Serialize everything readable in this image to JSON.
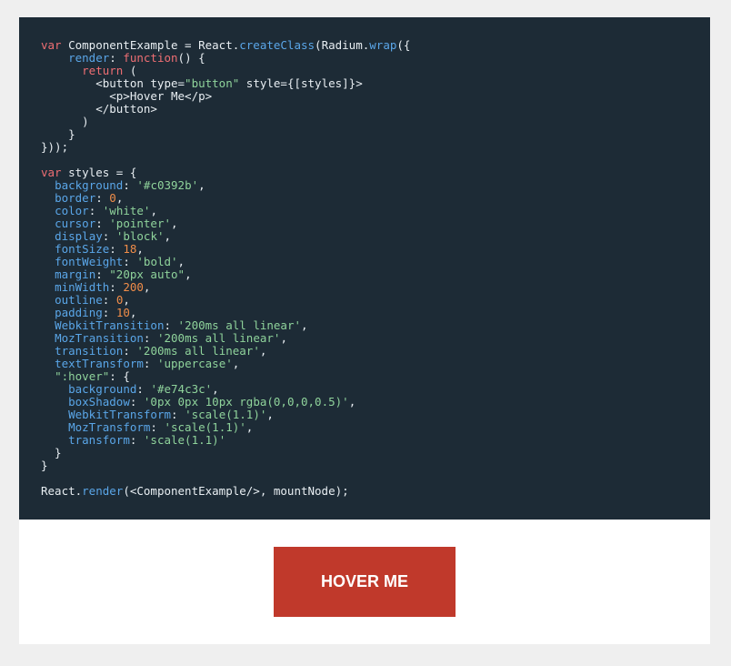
{
  "colors": {
    "page_background": "#efefef",
    "code_background": "#1d2b36",
    "keyword": "#ee6e73",
    "property": "#5aa6e8",
    "string": "#8fd39b",
    "number": "#f08d49",
    "plain_text": "#e8eef2",
    "button_background": "#c0392b",
    "button_text": "#ffffff"
  },
  "code_lines": [
    [
      [
        "kw",
        "var"
      ],
      [
        "txt",
        " ComponentExample = React."
      ],
      [
        "prop",
        "createClass"
      ],
      [
        "txt",
        "(Radium."
      ],
      [
        "prop",
        "wrap"
      ],
      [
        "txt",
        "({"
      ]
    ],
    [
      [
        "txt",
        "    "
      ],
      [
        "prop",
        "render"
      ],
      [
        "txt",
        ": "
      ],
      [
        "kw",
        "function"
      ],
      [
        "txt",
        "() {"
      ]
    ],
    [
      [
        "txt",
        "      "
      ],
      [
        "kw",
        "return"
      ],
      [
        "txt",
        " ("
      ]
    ],
    [
      [
        "txt",
        "        <button type="
      ],
      [
        "str",
        "\"button\""
      ],
      [
        "txt",
        " style={[styles]}>"
      ]
    ],
    [
      [
        "txt",
        "          <p>Hover Me</p>"
      ]
    ],
    [
      [
        "txt",
        "        </button>"
      ]
    ],
    [
      [
        "txt",
        "      )"
      ]
    ],
    [
      [
        "txt",
        "    }"
      ]
    ],
    [
      [
        "txt",
        "}));"
      ]
    ],
    [],
    [
      [
        "kw",
        "var"
      ],
      [
        "txt",
        " styles = {"
      ]
    ],
    [
      [
        "txt",
        "  "
      ],
      [
        "prop",
        "background"
      ],
      [
        "txt",
        ": "
      ],
      [
        "str",
        "'#c0392b'"
      ],
      [
        "txt",
        ","
      ]
    ],
    [
      [
        "txt",
        "  "
      ],
      [
        "prop",
        "border"
      ],
      [
        "txt",
        ": "
      ],
      [
        "num",
        "0"
      ],
      [
        "txt",
        ","
      ]
    ],
    [
      [
        "txt",
        "  "
      ],
      [
        "prop",
        "color"
      ],
      [
        "txt",
        ": "
      ],
      [
        "str",
        "'white'"
      ],
      [
        "txt",
        ","
      ]
    ],
    [
      [
        "txt",
        "  "
      ],
      [
        "prop",
        "cursor"
      ],
      [
        "txt",
        ": "
      ],
      [
        "str",
        "'pointer'"
      ],
      [
        "txt",
        ","
      ]
    ],
    [
      [
        "txt",
        "  "
      ],
      [
        "prop",
        "display"
      ],
      [
        "txt",
        ": "
      ],
      [
        "str",
        "'block'"
      ],
      [
        "txt",
        ","
      ]
    ],
    [
      [
        "txt",
        "  "
      ],
      [
        "prop",
        "fontSize"
      ],
      [
        "txt",
        ": "
      ],
      [
        "num",
        "18"
      ],
      [
        "txt",
        ","
      ]
    ],
    [
      [
        "txt",
        "  "
      ],
      [
        "prop",
        "fontWeight"
      ],
      [
        "txt",
        ": "
      ],
      [
        "str",
        "'bold'"
      ],
      [
        "txt",
        ","
      ]
    ],
    [
      [
        "txt",
        "  "
      ],
      [
        "prop",
        "margin"
      ],
      [
        "txt",
        ": "
      ],
      [
        "str",
        "\"20px auto\""
      ],
      [
        "txt",
        ","
      ]
    ],
    [
      [
        "txt",
        "  "
      ],
      [
        "prop",
        "minWidth"
      ],
      [
        "txt",
        ": "
      ],
      [
        "num",
        "200"
      ],
      [
        "txt",
        ","
      ]
    ],
    [
      [
        "txt",
        "  "
      ],
      [
        "prop",
        "outline"
      ],
      [
        "txt",
        ": "
      ],
      [
        "num",
        "0"
      ],
      [
        "txt",
        ","
      ]
    ],
    [
      [
        "txt",
        "  "
      ],
      [
        "prop",
        "padding"
      ],
      [
        "txt",
        ": "
      ],
      [
        "num",
        "10"
      ],
      [
        "txt",
        ","
      ]
    ],
    [
      [
        "txt",
        "  "
      ],
      [
        "prop",
        "WebkitTransition"
      ],
      [
        "txt",
        ": "
      ],
      [
        "str",
        "'200ms all linear'"
      ],
      [
        "txt",
        ","
      ]
    ],
    [
      [
        "txt",
        "  "
      ],
      [
        "prop",
        "MozTransition"
      ],
      [
        "txt",
        ": "
      ],
      [
        "str",
        "'200ms all linear'"
      ],
      [
        "txt",
        ","
      ]
    ],
    [
      [
        "txt",
        "  "
      ],
      [
        "prop",
        "transition"
      ],
      [
        "txt",
        ": "
      ],
      [
        "str",
        "'200ms all linear'"
      ],
      [
        "txt",
        ","
      ]
    ],
    [
      [
        "txt",
        "  "
      ],
      [
        "prop",
        "textTransform"
      ],
      [
        "txt",
        ": "
      ],
      [
        "str",
        "'uppercase'"
      ],
      [
        "txt",
        ","
      ]
    ],
    [
      [
        "txt",
        "  "
      ],
      [
        "str",
        "\":hover\""
      ],
      [
        "txt",
        ": {"
      ]
    ],
    [
      [
        "txt",
        "    "
      ],
      [
        "prop",
        "background"
      ],
      [
        "txt",
        ": "
      ],
      [
        "str",
        "'#e74c3c'"
      ],
      [
        "txt",
        ","
      ]
    ],
    [
      [
        "txt",
        "    "
      ],
      [
        "prop",
        "boxShadow"
      ],
      [
        "txt",
        ": "
      ],
      [
        "str",
        "'0px 0px 10px rgba(0,0,0,0.5)'"
      ],
      [
        "txt",
        ","
      ]
    ],
    [
      [
        "txt",
        "    "
      ],
      [
        "prop",
        "WebkitTransform"
      ],
      [
        "txt",
        ": "
      ],
      [
        "str",
        "'scale(1.1)'"
      ],
      [
        "txt",
        ","
      ]
    ],
    [
      [
        "txt",
        "    "
      ],
      [
        "prop",
        "MozTransform"
      ],
      [
        "txt",
        ": "
      ],
      [
        "str",
        "'scale(1.1)'"
      ],
      [
        "txt",
        ","
      ]
    ],
    [
      [
        "txt",
        "    "
      ],
      [
        "prop",
        "transform"
      ],
      [
        "txt",
        ": "
      ],
      [
        "str",
        "'scale(1.1)'"
      ]
    ],
    [
      [
        "txt",
        "  }"
      ]
    ],
    [
      [
        "txt",
        "}"
      ]
    ],
    [],
    [
      [
        "txt",
        "React."
      ],
      [
        "prop",
        "render"
      ],
      [
        "txt",
        "(<ComponentExample/>, mountNode);"
      ]
    ]
  ],
  "preview": {
    "button_label": "Hover Me"
  }
}
